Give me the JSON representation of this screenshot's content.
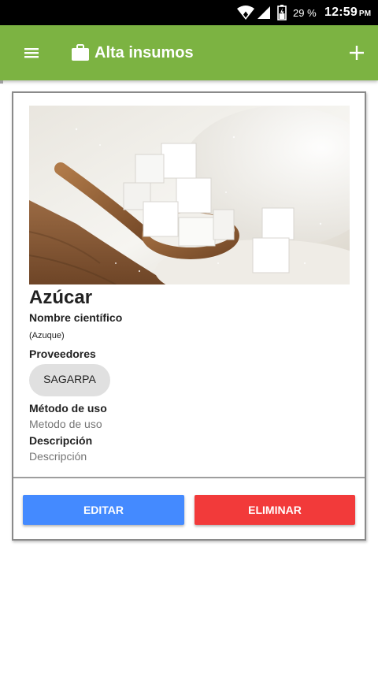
{
  "status_bar": {
    "battery": "29 %",
    "time": "12:59",
    "ampm": "PM",
    "icons": [
      "wifi-icon",
      "signal-icon",
      "battery-icon"
    ]
  },
  "app_bar": {
    "title": "Alta insumos",
    "icons": [
      "menu-icon",
      "briefcase-icon",
      "add-icon"
    ],
    "color": "#7cb342"
  },
  "item": {
    "name": "Azúcar",
    "scientific_label": "Nombre científico",
    "scientific_value": "(Azuque)",
    "suppliers_label": "Proveedores",
    "suppliers": [
      "SAGARPA"
    ],
    "method_label": "Método de uso",
    "method_value": "Metodo de uso",
    "description_label": "Descripción",
    "description_value": "Descripción"
  },
  "actions": {
    "edit_label": "EDITAR",
    "delete_label": "ELIMINAR",
    "edit_color": "#448aff",
    "delete_color": "#f23a3a"
  }
}
